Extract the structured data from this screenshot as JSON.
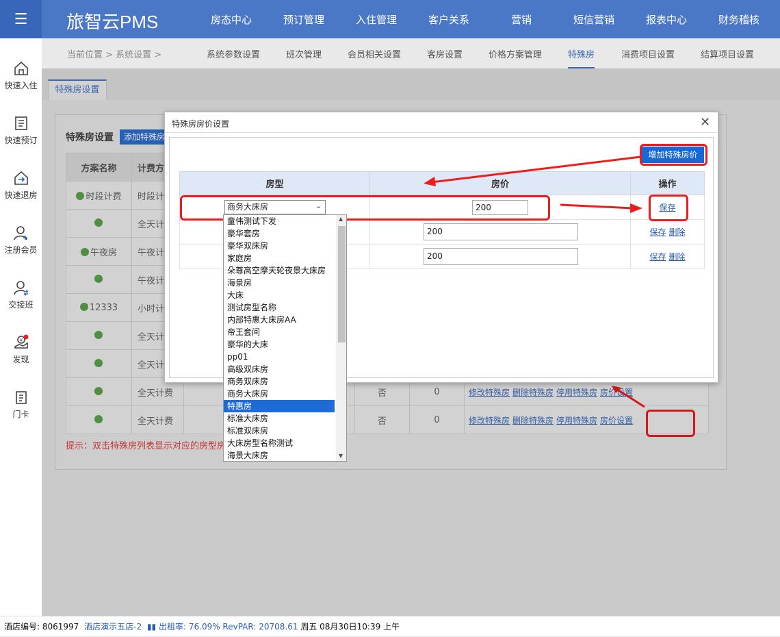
{
  "app": {
    "title": "旅智云PMS",
    "nav": [
      "房态中心",
      "预订管理",
      "入住管理",
      "客户关系",
      "营销",
      "短信营销",
      "报表中心",
      "财务稽核"
    ]
  },
  "sidebar": {
    "items": [
      {
        "label": "快速入住",
        "icon": "home-icon"
      },
      {
        "label": "快速预订",
        "icon": "document-icon"
      },
      {
        "label": "快速退房",
        "icon": "checkout-icon"
      },
      {
        "label": "注册会员",
        "icon": "add-user-icon"
      },
      {
        "label": "交接班",
        "icon": "shift-icon"
      },
      {
        "label": "发现",
        "icon": "discover-icon"
      },
      {
        "label": "门卡",
        "icon": "card-icon"
      }
    ]
  },
  "breadcrumb": {
    "current": "当前位置 > 系统设置 >"
  },
  "subnav": [
    "系统参数设置",
    "班次管理",
    "会员相关设置",
    "客房设置",
    "价格方案管理",
    "特殊房",
    "消费项目设置",
    "结算项目设置"
  ],
  "tab": {
    "label": "特殊房设置"
  },
  "panel": {
    "title": "特殊房设置",
    "add_button": "添加特殊房",
    "hint": "提示：双击特殊房列表显示对应的房型房",
    "headers": [
      "方案名称",
      "计费方"
    ],
    "rows": [
      {
        "name": "时段计费",
        "mode": "时段计"
      },
      {
        "name": "",
        "mode": "全天计"
      },
      {
        "name": "午夜房",
        "mode": "午夜计"
      },
      {
        "name": "",
        "mode": "午夜计"
      },
      {
        "name": "12333",
        "mode": "小时计"
      },
      {
        "name": "",
        "mode": "全天计"
      },
      {
        "name": "",
        "mode": "全天计"
      },
      {
        "name": "",
        "mode": "全天计费",
        "flag": "否",
        "count": "0",
        "actions": [
          "修改特殊房",
          "删除特殊房",
          "停用特殊房",
          "房价设置"
        ]
      },
      {
        "name": "",
        "mode": "全天计费",
        "flag": "否",
        "count": "0",
        "actions": [
          "修改特殊房",
          "删除特殊房",
          "停用特殊房",
          "房价设置"
        ]
      }
    ]
  },
  "modal": {
    "title": "特殊房房价设置",
    "add_button": "增加特殊房价",
    "headers": [
      "房型",
      "房价",
      "操作"
    ],
    "rows": [
      {
        "room_type": "商务大床房",
        "price": "200",
        "actions": [
          "保存"
        ]
      },
      {
        "room_type": "",
        "price": "200",
        "actions": [
          "保存",
          "删除"
        ]
      },
      {
        "room_type": "",
        "price": "200",
        "actions": [
          "保存",
          "删除"
        ]
      }
    ]
  },
  "dropdown": {
    "options": [
      "童伟测试下发",
      "豪华套房",
      "豪华双床房",
      "家庭房",
      "朵尊高空摩天轮夜景大床房",
      "海景房",
      "大床",
      "测试房型名称",
      "内部特惠大床房AA",
      "帝王套间",
      "豪华的大床",
      "pp01",
      "高级双床房",
      "商务双床房",
      "商务大床房",
      "特惠房",
      "标准大床房",
      "标准双床房",
      "大床房型名称测试",
      "海景大床房"
    ],
    "selected_index": 15
  },
  "status": {
    "hotel_no_label": "酒店编号:",
    "hotel_no": "8061997",
    "hotel_name": "酒店演示五店-2",
    "occupancy": "出租率: 76.09% RevPAR: 20708.61",
    "datetime": "周五 08月30日10:39 上午"
  },
  "colors": {
    "brand": "#4a78c7",
    "accent": "#1966d6",
    "annotation": "#f21b1b"
  }
}
